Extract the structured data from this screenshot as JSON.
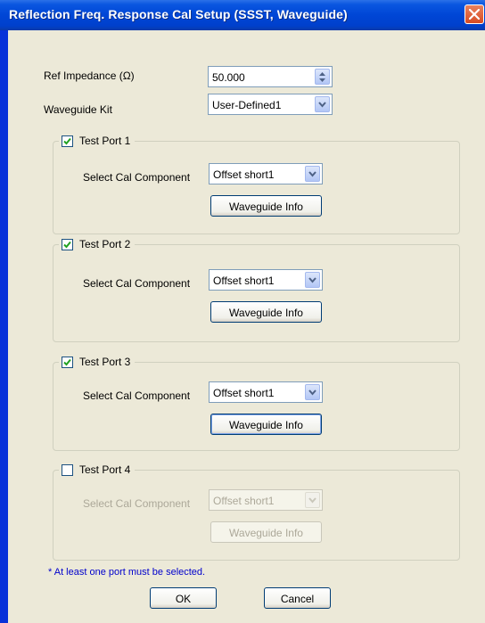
{
  "window": {
    "title": "Reflection Freq. Response Cal Setup (SSST, Waveguide)"
  },
  "ref_impedance": {
    "label": "Ref Impedance (Ω)",
    "value": "50.000"
  },
  "waveguide_kit": {
    "label": "Waveguide Kit",
    "value": "User-Defined1"
  },
  "ports": [
    {
      "label": "Test Port 1",
      "checked": true,
      "enabled": true,
      "component_label": "Select Cal Component",
      "component_value": "Offset short1",
      "info_button": "Waveguide Info"
    },
    {
      "label": "Test Port 2",
      "checked": true,
      "enabled": true,
      "component_label": "Select Cal Component",
      "component_value": "Offset short1",
      "info_button": "Waveguide Info"
    },
    {
      "label": "Test Port 3",
      "checked": true,
      "enabled": true,
      "component_label": "Select Cal Component",
      "component_value": "Offset short1",
      "info_button": "Waveguide Info"
    },
    {
      "label": "Test Port 4",
      "checked": false,
      "enabled": false,
      "component_label": "Select Cal Component",
      "component_value": "Offset short1",
      "info_button": "Waveguide Info"
    }
  ],
  "note": "* At least one port must be selected.",
  "buttons": {
    "ok": "OK",
    "cancel": "Cancel"
  },
  "colors": {
    "titlebar": "#0046d6",
    "dialog_bg": "#ece9d8",
    "note": "#0000cc",
    "disabled_text": "#aca899"
  },
  "icons": {
    "close": "close-icon",
    "spin": "spin-arrows-icon",
    "dropdown": "chevron-down-icon",
    "check": "check-icon"
  }
}
